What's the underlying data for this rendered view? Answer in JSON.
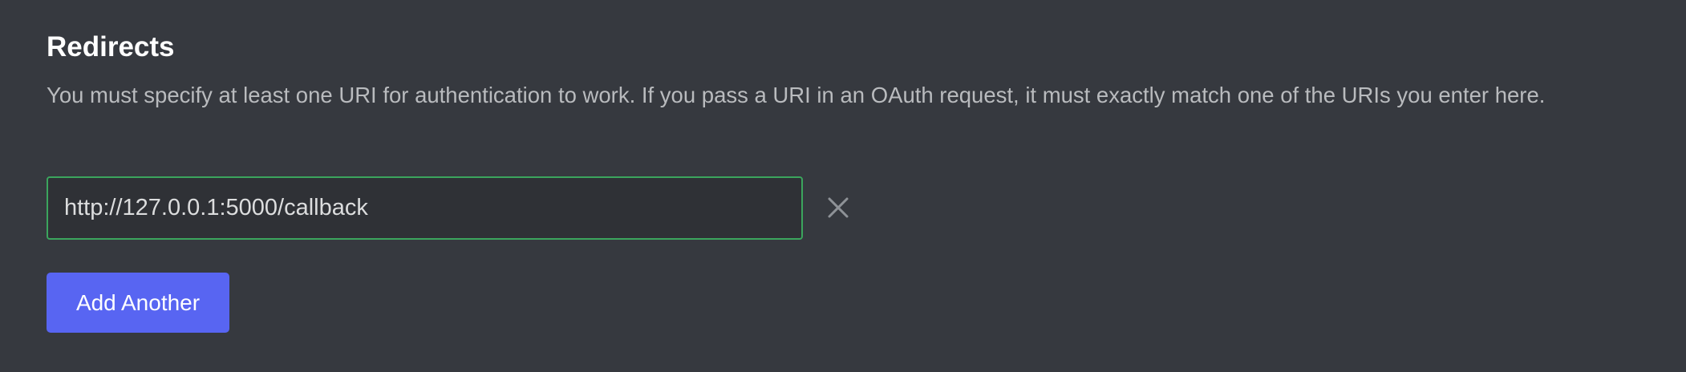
{
  "redirects": {
    "title": "Redirects",
    "description": "You must specify at least one URI for authentication to work. If you pass a URI in an OAuth request, it must exactly match one of the URIs you enter here.",
    "uris": [
      {
        "value": "http://127.0.0.1:5000/callback",
        "remove_icon": "close-icon"
      }
    ],
    "add_button_label": "Add Another"
  },
  "colors": {
    "background": "#36393f",
    "input_background": "#2f3136",
    "input_border_valid": "#3ba55d",
    "primary_button": "#5865f2",
    "heading_text": "#ffffff",
    "body_text": "#b9bbbe"
  }
}
